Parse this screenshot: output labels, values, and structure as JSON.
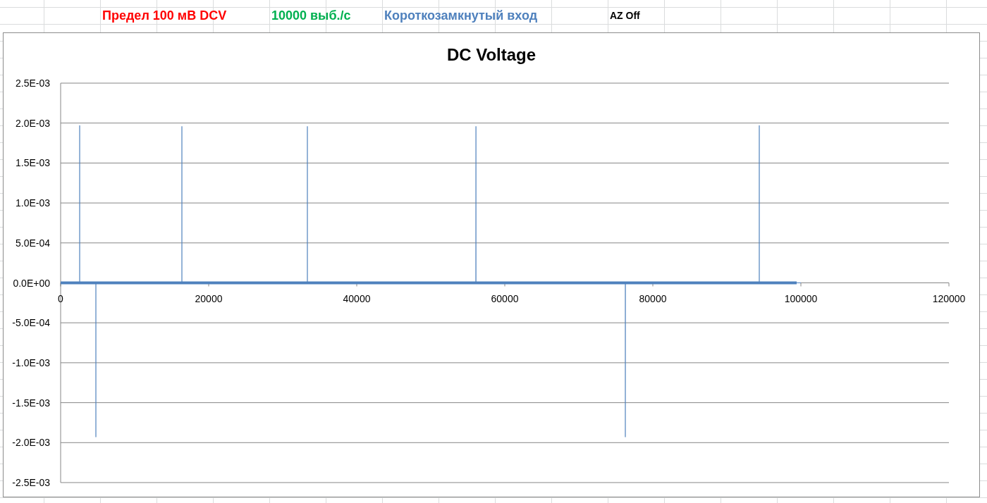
{
  "sheet": {
    "header_cells": [
      {
        "text": "Предел 100 мВ DCV",
        "color": "#ff0000"
      },
      {
        "text": "10000 выб./с",
        "color": "#00b050"
      },
      {
        "text": "Короткозамкнутый вход",
        "color": "#4f81bd"
      },
      {
        "text": "AZ Off",
        "color": "#000000"
      }
    ]
  },
  "chart": {
    "chart_data": {
      "type": "line",
      "title": "DC Voltage",
      "grid": true,
      "xlim": [
        0,
        120000
      ],
      "ylim": [
        -0.0025,
        0.0025
      ],
      "xticks": [
        0,
        20000,
        40000,
        60000,
        80000,
        100000,
        120000
      ],
      "yticks": [
        {
          "value": 0.0025,
          "label": "2.5E-03"
        },
        {
          "value": 0.002,
          "label": "2.0E-03"
        },
        {
          "value": 0.0015,
          "label": "1.5E-03"
        },
        {
          "value": 0.001,
          "label": "1.0E-03"
        },
        {
          "value": 0.0005,
          "label": "5.0E-04"
        },
        {
          "value": 0,
          "label": "0.0E+00"
        },
        {
          "value": -0.0005,
          "label": "-5.0E-04"
        },
        {
          "value": -0.001,
          "label": "-1.0E-03"
        },
        {
          "value": -0.0015,
          "label": "-1.5E-03"
        },
        {
          "value": -0.002,
          "label": "-2.0E-03"
        },
        {
          "value": -0.0025,
          "label": "-2.5E-03"
        }
      ],
      "x": [
        0,
        2569,
        2570,
        2571,
        4759,
        4760,
        4761,
        16379,
        16380,
        16381,
        33329,
        33330,
        33331,
        56099,
        56100,
        56101,
        76289,
        76290,
        76291,
        94379,
        94380,
        94381,
        100000
      ],
      "series": [
        {
          "color": "#4f81bd",
          "values": [
            0,
            0,
            0.00197,
            0,
            0,
            -0.00193,
            0,
            0,
            0.00196,
            0,
            0,
            0.00196,
            0,
            0,
            0.00196,
            0,
            0,
            -0.00193,
            0,
            0,
            0.00197,
            0,
            0
          ]
        }
      ]
    }
  }
}
